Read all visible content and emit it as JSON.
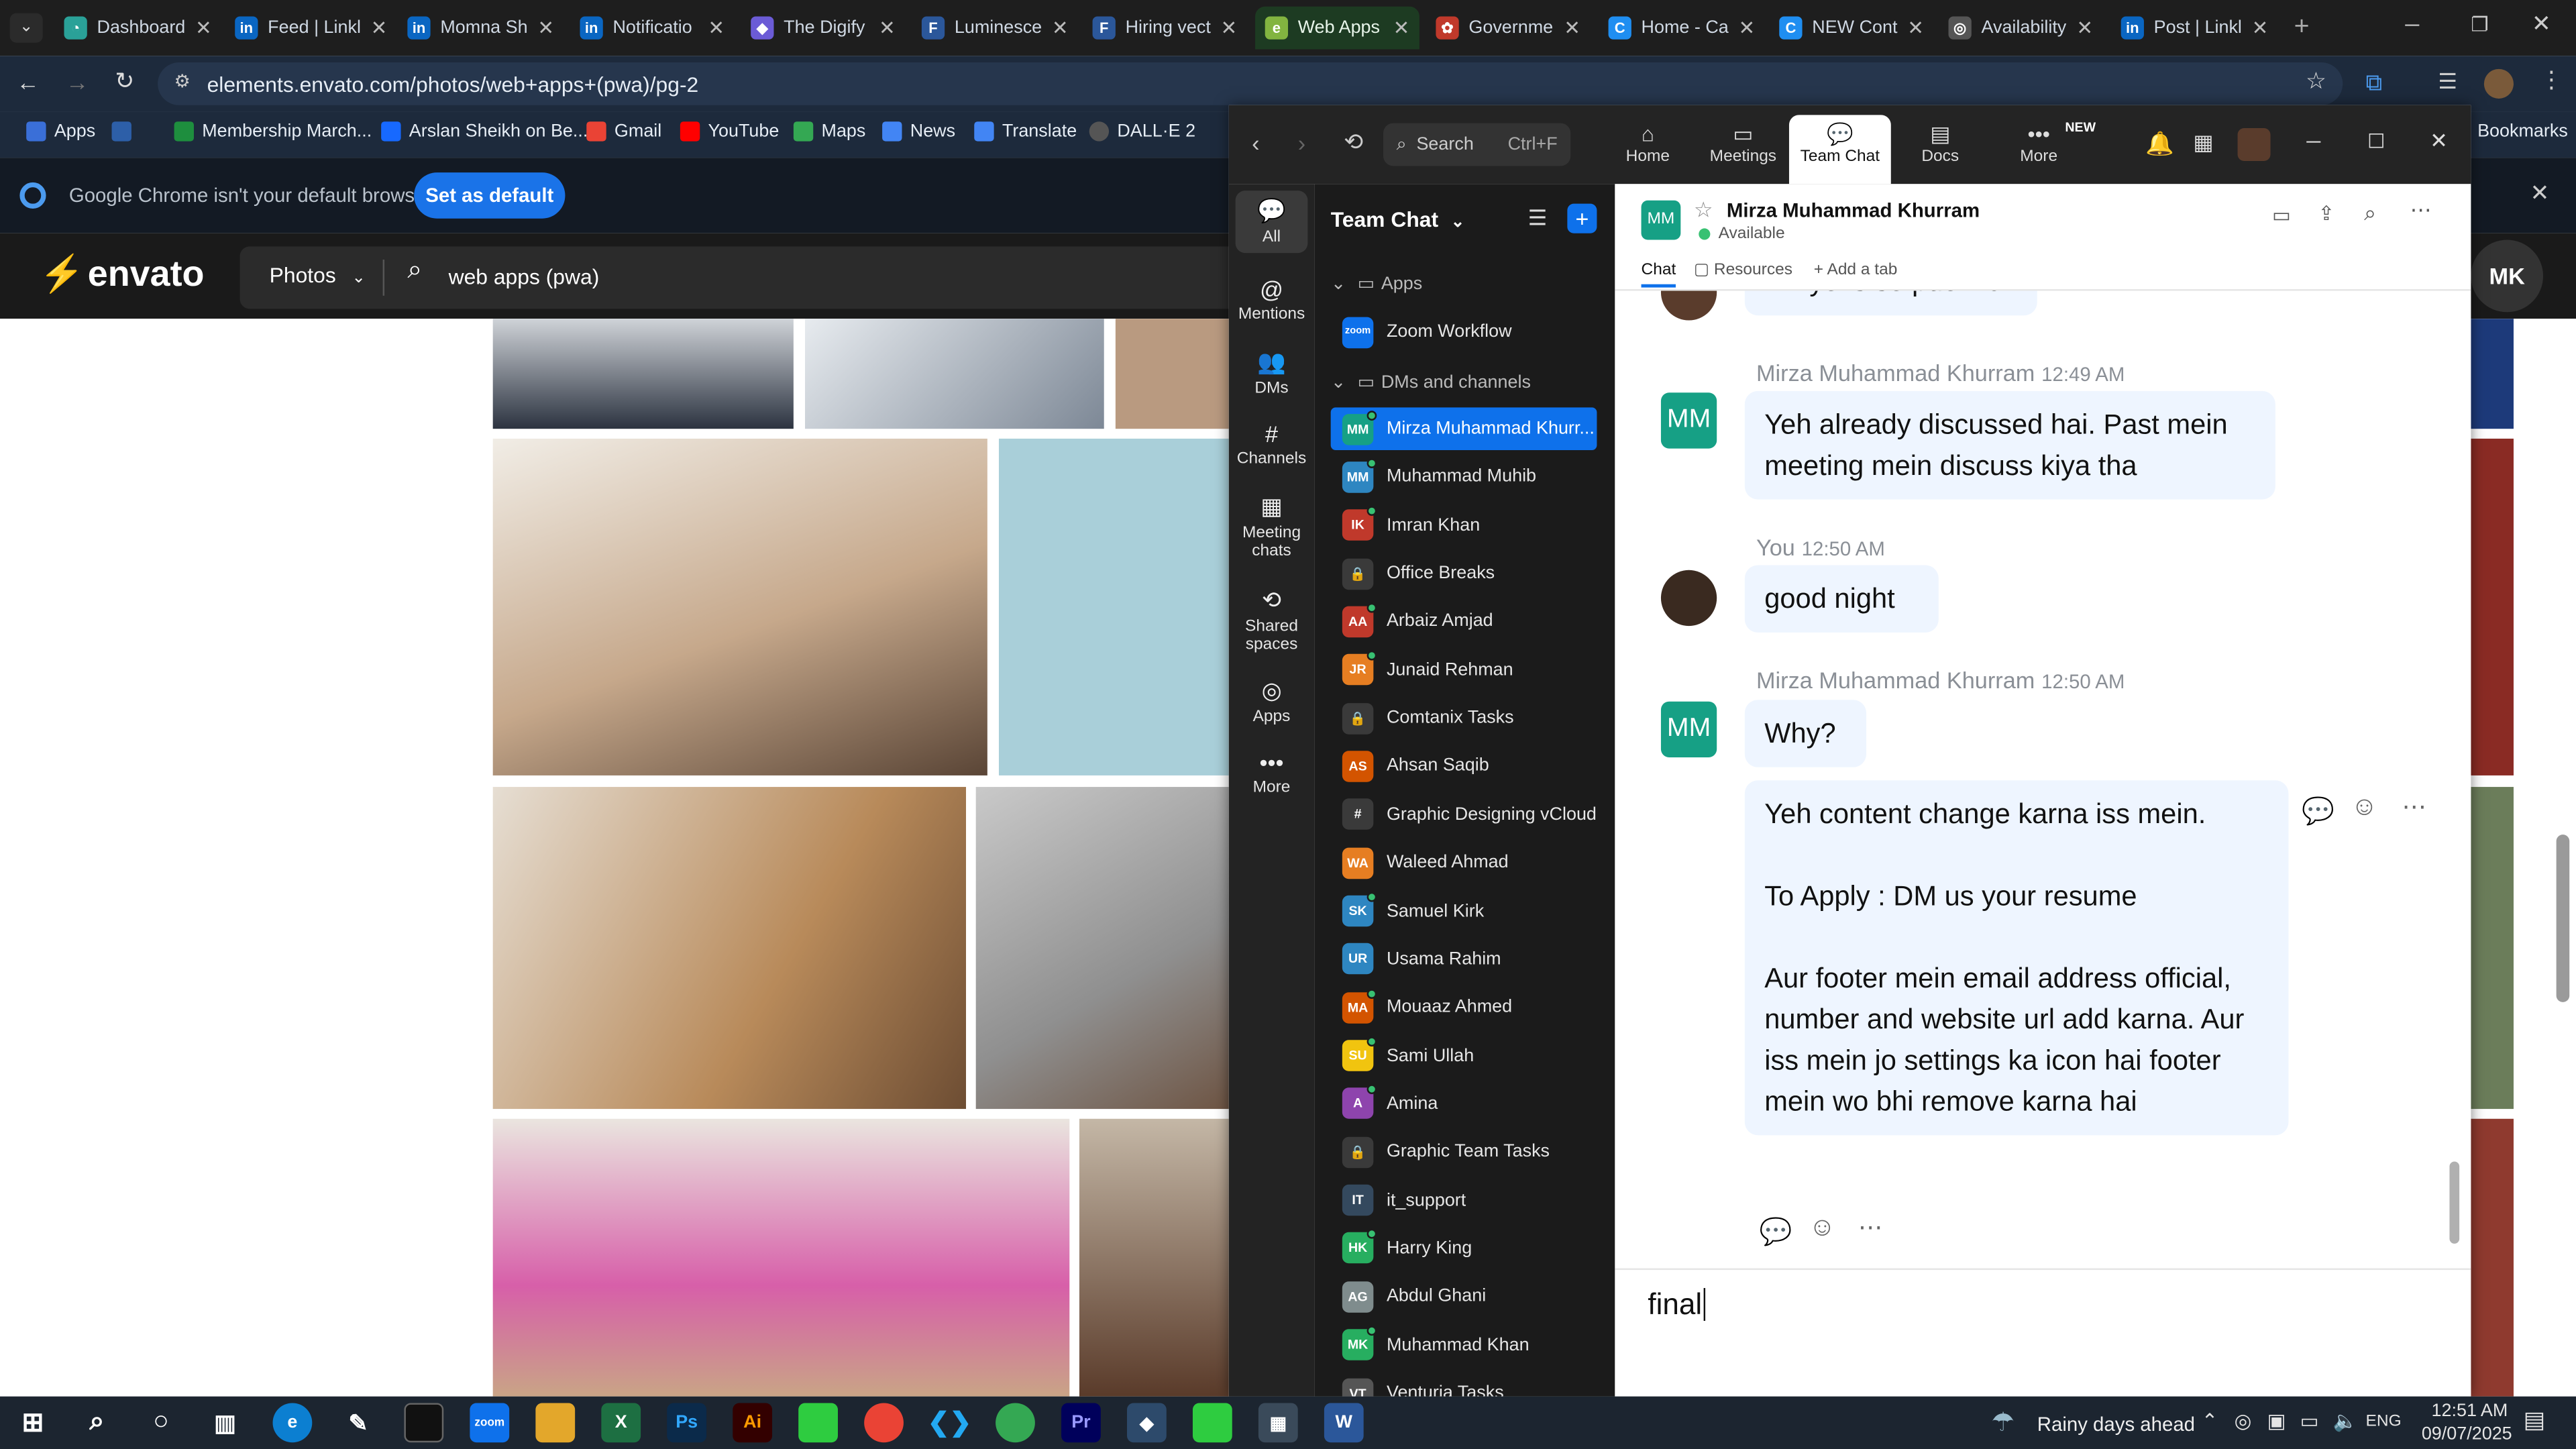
{
  "browser": {
    "tabs": [
      {
        "label": "Dashboard",
        "color": "#2aa198",
        "glyph": "◔"
      },
      {
        "label": "Feed | Linkl",
        "color": "#0a66c2",
        "glyph": "in"
      },
      {
        "label": "Momna Sh",
        "color": "#0a66c2",
        "glyph": "in"
      },
      {
        "label": "Notificatio",
        "color": "#0a66c2",
        "glyph": "in"
      },
      {
        "label": "The Digify",
        "color": "#6b5bd6",
        "glyph": "◆"
      },
      {
        "label": "Luminesce",
        "color": "#2b579a",
        "glyph": "F"
      },
      {
        "label": "Hiring vect",
        "color": "#2b579a",
        "glyph": "F"
      },
      {
        "label": "Web Apps",
        "color": "#82b440",
        "glyph": "e"
      },
      {
        "label": "Governme",
        "color": "#c0392b",
        "glyph": "✿"
      },
      {
        "label": "Home - Ca",
        "color": "#1f8ef1",
        "glyph": "C"
      },
      {
        "label": "NEW Cont",
        "color": "#1f8ef1",
        "glyph": "C"
      },
      {
        "label": "Availability",
        "color": "#555555",
        "glyph": "◎"
      },
      {
        "label": "Post | Linkl",
        "color": "#0a66c2",
        "glyph": "in"
      }
    ],
    "url": "elements.envato.com/photos/web+apps+(pwa)/pg-2",
    "bookmarks": [
      "Apps",
      "Membership March...",
      "Arslan Sheikh on Be...",
      "Gmail",
      "YouTube",
      "Maps",
      "News",
      "Translate",
      "DALL·E 2"
    ],
    "bookmarks_right": "Bookmarks",
    "infobar": {
      "message": "Google Chrome isn't your default browser",
      "button": "Set as default"
    }
  },
  "envato": {
    "logo": "envato",
    "category": "Photos",
    "search_value": "web apps (pwa)",
    "avatar": "MK"
  },
  "zoom": {
    "search_placeholder": "Search",
    "search_shortcut": "Ctrl+F",
    "nav": [
      {
        "label": "Home",
        "icon": "⌂"
      },
      {
        "label": "Meetings",
        "icon": "▭"
      },
      {
        "label": "Team Chat",
        "icon": "💬"
      },
      {
        "label": "Docs",
        "icon": "▤"
      },
      {
        "label": "More",
        "icon": "•••"
      }
    ],
    "new_badge": "NEW",
    "rail": [
      {
        "label": "All",
        "icon": "💬"
      },
      {
        "label": "Mentions",
        "icon": "@"
      },
      {
        "label": "DMs",
        "icon": "👥"
      },
      {
        "label": "Channels",
        "icon": "#"
      },
      {
        "label": "Meeting chats",
        "icon": "▦"
      },
      {
        "label": "Shared spaces",
        "icon": "⟲"
      },
      {
        "label": "Apps",
        "icon": "◎"
      },
      {
        "label": "More",
        "icon": "•••"
      }
    ],
    "list_title": "Team Chat",
    "apps_header": "Apps",
    "apps": [
      "Zoom Workflow"
    ],
    "dm_header": "DMs and channels",
    "contacts": [
      {
        "name": "Mirza Muhammad Khurr...",
        "init": "MM",
        "color": "#16a085",
        "online": true,
        "selected": true
      },
      {
        "name": "Muhammad Muhib",
        "init": "MM",
        "color": "#2e86c1",
        "online": true
      },
      {
        "name": "Imran Khan",
        "init": "IK",
        "color": "#c0392b",
        "online": true
      },
      {
        "name": "Office Breaks",
        "init": "🔒",
        "color": "#3a3a3a"
      },
      {
        "name": "Arbaiz Amjad",
        "init": "AA",
        "color": "#c0392b",
        "online": true
      },
      {
        "name": "Junaid Rehman",
        "init": "JR",
        "color": "#e67e22",
        "online": true
      },
      {
        "name": "Comtanix Tasks",
        "init": "🔒",
        "color": "#3a3a3a"
      },
      {
        "name": "Ahsan Saqib",
        "init": "AS",
        "color": "#d35400",
        "online": false
      },
      {
        "name": "Graphic Designing vCloud",
        "init": "#",
        "color": "#3a3a3a"
      },
      {
        "name": "Waleed Ahmad",
        "init": "WA",
        "color": "#e67e22",
        "online": false
      },
      {
        "name": "Samuel Kirk",
        "init": "SK",
        "color": "#2e86c1",
        "online": true
      },
      {
        "name": "Usama Rahim",
        "init": "UR",
        "color": "#2e86c1",
        "online": false
      },
      {
        "name": "Mouaaz Ahmed",
        "init": "MA",
        "color": "#d35400",
        "online": true
      },
      {
        "name": "Sami Ullah",
        "init": "SU",
        "color": "#f1c40f",
        "online": true
      },
      {
        "name": "Amina",
        "init": "A",
        "color": "#8e44ad",
        "online": true
      },
      {
        "name": "Graphic Team Tasks",
        "init": "🔒",
        "color": "#3a3a3a"
      },
      {
        "name": "it_support",
        "init": "IT",
        "color": "#34495e",
        "online": false
      },
      {
        "name": "Harry King",
        "init": "HK",
        "color": "#27ae60",
        "online": true
      },
      {
        "name": "Abdul Ghani",
        "init": "AG",
        "color": "#7f8c8d",
        "online": false
      },
      {
        "name": "Muhammad Khan",
        "init": "MK",
        "color": "#27ae60",
        "online": true
      },
      {
        "name": "Venturia Tasks",
        "init": "VT",
        "color": "#555555",
        "online": false
      }
    ],
    "chat": {
      "name": "Mirza Muhammad Khurram",
      "init": "MM",
      "status": "Available",
      "tabs": [
        "Chat",
        "Resources",
        "Add a tab"
      ],
      "partial": "Ikh ye is se puch lo",
      "messages": [
        {
          "sender": "Mirza Muhammad Khurram",
          "time": "12:49 AM",
          "text": "Yeh already discussed hai. Past mein meeting mein discuss kiya tha"
        },
        {
          "sender": "You",
          "time": "12:50 AM",
          "text": "good night"
        },
        {
          "sender": "Mirza Muhammad Khurram",
          "time": "12:50 AM",
          "text": "Why?"
        },
        {
          "sender": "",
          "time": "",
          "text": "Yeh content change karna iss mein.\n\nTo Apply : DM us your resume\n\nAur footer mein email address official, number and website url add karna. Aur iss mein jo settings ka icon hai footer mein wo bhi remove karna hai"
        }
      ],
      "composer": "final"
    }
  },
  "taskbar": {
    "weather": "Rainy days ahead",
    "lang": "ENG",
    "time": "12:51 AM",
    "date": "09/07/2025"
  }
}
